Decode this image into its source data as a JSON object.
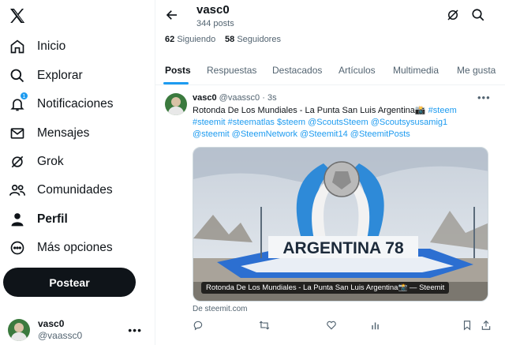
{
  "sidebar": {
    "items": [
      {
        "label": "Inicio",
        "icon": "home-icon"
      },
      {
        "label": "Explorar",
        "icon": "search-icon"
      },
      {
        "label": "Notificaciones",
        "icon": "bell-icon",
        "badge": "1"
      },
      {
        "label": "Mensajes",
        "icon": "envelope-icon"
      },
      {
        "label": "Grok",
        "icon": "grok-icon"
      },
      {
        "label": "Comunidades",
        "icon": "people-icon"
      },
      {
        "label": "Perfil",
        "icon": "person-icon",
        "active": true
      },
      {
        "label": "Más opciones",
        "icon": "more-circle-icon"
      }
    ],
    "post_button": "Postear",
    "account": {
      "name": "vasc0",
      "handle": "@vaassc0"
    }
  },
  "profile_header": {
    "title": "vasc0",
    "posts_count": "344 posts",
    "following_count": "62",
    "following_label": "Siguiendo",
    "followers_count": "58",
    "followers_label": "Seguidores"
  },
  "tabs": [
    "Posts",
    "Respuestas",
    "Destacados",
    "Artículos",
    "Multimedia",
    "Me gusta"
  ],
  "active_tab": "Posts",
  "tweet": {
    "name": "vasc0",
    "handle": "@vaassc0",
    "time": "· 3s",
    "text_plain": "Rotonda De Los Mundiales - La Punta San Luis Argentina📸 ",
    "tags_line1": "#steem",
    "line2": "#steemit #steematlas $steem @ScoutsSteem @Scoutsysusamig1",
    "line3": "@steemit @SteemNetwork @Steemit14 @SteemitPosts",
    "image_sign_text": "ARGENTINA 78",
    "card_caption": "Rotonda De Los Mundiales - La Punta San Luis Argentina📸 — Steemit",
    "card_source": "De steemit.com"
  },
  "colors": {
    "accent": "#1d9bf0",
    "text": "#0f1419",
    "muted": "#536471",
    "post_button_bg": "#0f1419"
  }
}
